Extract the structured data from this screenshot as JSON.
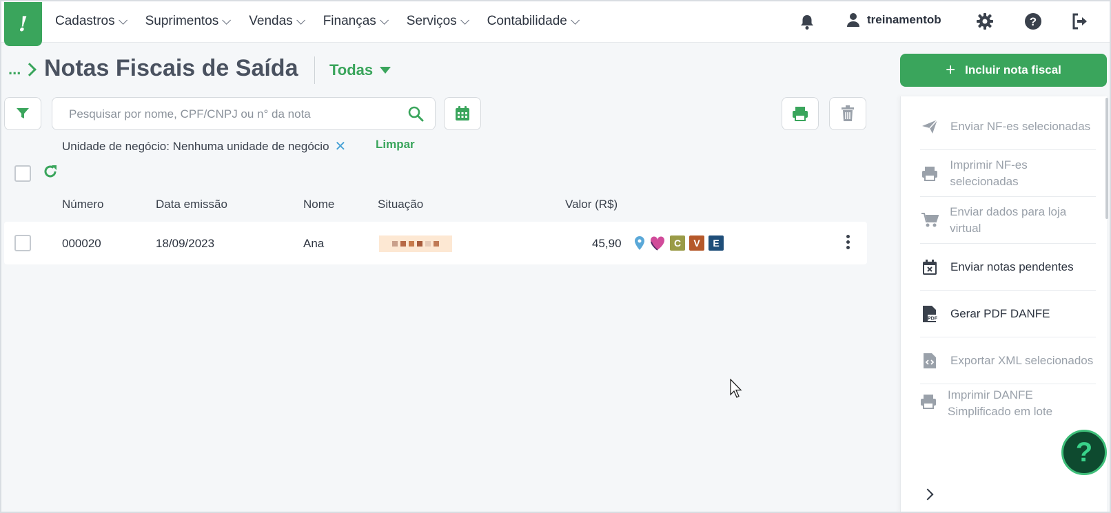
{
  "app": {
    "logo_text": "!"
  },
  "nav": [
    {
      "label": "Cadastros"
    },
    {
      "label": "Suprimentos"
    },
    {
      "label": "Vendas"
    },
    {
      "label": "Finanças"
    },
    {
      "label": "Serviços"
    },
    {
      "label": "Contabilidade"
    }
  ],
  "header": {
    "username": "treinamentob"
  },
  "page": {
    "breadcrumb": "...",
    "title": "Notas Fiscais de Saída",
    "filter_label": "Todas"
  },
  "search": {
    "placeholder": "Pesquisar por nome, CPF/CNPJ ou n° da nota",
    "value": ""
  },
  "active_filter": {
    "text": "Unidade de negócio: Nenhuma unidade de negócio",
    "clear_label": "Limpar"
  },
  "table": {
    "columns": [
      "Número",
      "Data emissão",
      "Nome",
      "Situação",
      "Valor (R$)"
    ],
    "rows": [
      {
        "numero": "000020",
        "data": "18/09/2023",
        "nome": "Ana",
        "valor": "45,90",
        "badges": [
          "C",
          "V",
          "E"
        ]
      }
    ]
  },
  "actions": {
    "include_label": "Incluir nota fiscal",
    "panel": [
      {
        "label": "Enviar NF-es selecionadas",
        "icon": "send-icon",
        "enabled": false
      },
      {
        "label": "Imprimir NF-es selecionadas",
        "icon": "printer-icon",
        "enabled": false
      },
      {
        "label": "Enviar dados para loja virtual",
        "icon": "cart-icon",
        "enabled": false
      },
      {
        "label": "Enviar notas pendentes",
        "icon": "calendar-x-icon",
        "enabled": true
      },
      {
        "label": "Gerar PDF DANFE",
        "icon": "pdf-icon",
        "enabled": true
      },
      {
        "label": "Exportar XML selecionados",
        "icon": "code-file-icon",
        "enabled": false
      },
      {
        "label": "Imprimir DANFE Simplificado em lote",
        "icon": "printer-icon",
        "enabled": false
      }
    ]
  },
  "colors": {
    "accent": "#3aa55c",
    "badge_c": "#9a9b47",
    "badge_v": "#b5582a",
    "badge_e": "#1f4e79",
    "fab": "#0e4a2f"
  },
  "help_fab": {
    "symbol": "?"
  }
}
